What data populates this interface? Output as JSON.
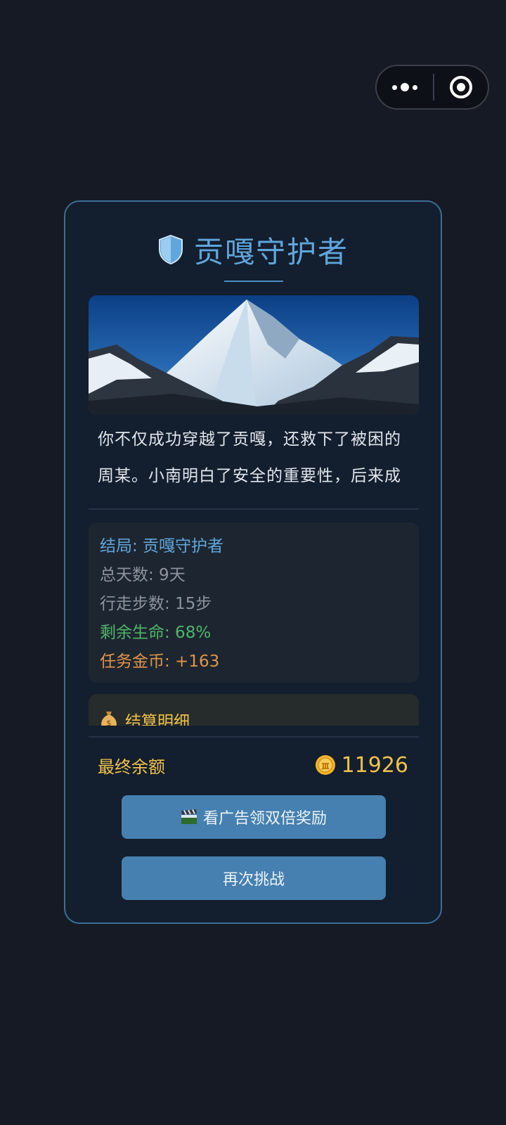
{
  "capsule": {
    "more_icon": "more-dots-icon",
    "close_icon": "target-close-icon"
  },
  "header": {
    "icon": "shield-icon",
    "title": "贡嘎守护者"
  },
  "hero_image": {
    "description_icon": "snow-mountain-image"
  },
  "story": {
    "text": "你不仅成功穿越了贡嘎，还救下了被困的周某。小南明白了安全的重要性，后来成"
  },
  "stats": [
    {
      "text": "结局: 贡嘎守护者",
      "color": "#5fa6dc"
    },
    {
      "text": "总天数: 9天",
      "color": "#8c939c"
    },
    {
      "text": "行走步数: 15步",
      "color": "#8c939c"
    },
    {
      "text": "剩余生命: 68%",
      "color": "#4fb568"
    },
    {
      "text": "任务金币: +163",
      "color": "#e19447"
    }
  ],
  "detail": {
    "icon": "money-bag-icon",
    "title": "结算明细"
  },
  "balance": {
    "label": "最终余额",
    "icon": "coin-icon",
    "value": "11926"
  },
  "buttons": {
    "ad_icon": "clapperboard-icon",
    "ad_label": "看广告领双倍奖励",
    "retry_label": "再次挑战"
  },
  "colors": {
    "background": "#161a24",
    "card": "#131e2e",
    "card_border": "#3a6f95",
    "accent": "#5fa6dc",
    "gold": "#f0c24a",
    "button": "#4580b0"
  }
}
